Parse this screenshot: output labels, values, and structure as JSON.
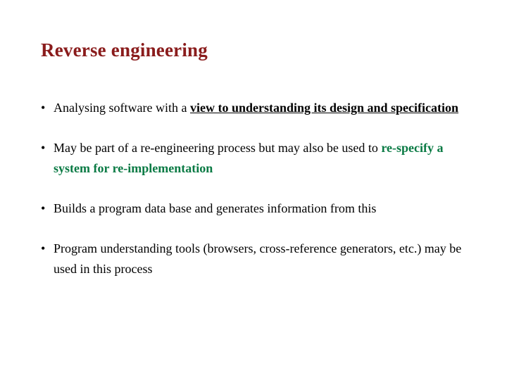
{
  "title": "Reverse engineering",
  "items": [
    {
      "pre": "Analysing software with a ",
      "emph": "view to understanding its design and specification",
      "post": ""
    },
    {
      "pre": "May be part of a re-engineering process but may also be used to ",
      "emph2": "re-specify a system for re-implementation",
      "post": ""
    },
    {
      "plain": "Builds a program data base and generates information from this"
    },
    {
      "plain": "Program understanding tools (browsers, cross-reference generators, etc.) may be used in this process"
    }
  ]
}
